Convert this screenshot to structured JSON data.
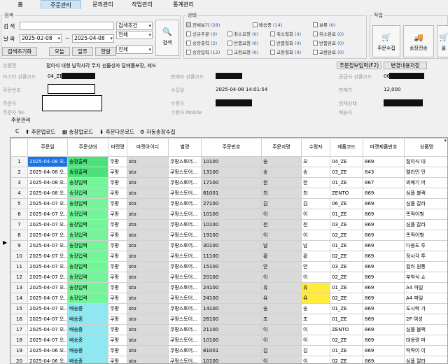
{
  "tabs": [
    "홈",
    "주문관리",
    "문의관리",
    "작업관리",
    "통계관리"
  ],
  "search": {
    "title": "검색",
    "search_label": "검 색",
    "search_condition": "검색조건",
    "all": "전체",
    "date_label": "날 짜",
    "date_from": "2025-02-08",
    "date_to": "2025-04-08",
    "date_type": "등록일",
    "tilde": "~",
    "reset": "검색조기화",
    "today": "오늘",
    "week": "일주",
    "month": "한달",
    "search_button": "검색"
  },
  "status": {
    "title": "상태",
    "items": [
      {
        "label": "전체보기",
        "count": "(28)"
      },
      {
        "label": "배송중",
        "count": "(14)"
      },
      {
        "label": "보류",
        "count": "(0)"
      },
      {
        "label": "신규주문",
        "count": "(0)"
      },
      {
        "label": "취소요청",
        "count": "(0)"
      },
      {
        "label": "취소철회",
        "count": "(0)"
      },
      {
        "label": "취소완료",
        "count": "(0)"
      },
      {
        "label": "송장출력",
        "count": "(2)"
      },
      {
        "label": "반품요청",
        "count": "(0)"
      },
      {
        "label": "반품철회",
        "count": "(0)"
      },
      {
        "label": "반품완료",
        "count": "(0)"
      },
      {
        "label": "송장입력",
        "count": "(12)"
      },
      {
        "label": "교환요청",
        "count": "(0)"
      },
      {
        "label": "교환철회",
        "count": "(0)"
      },
      {
        "label": "교환완료",
        "count": "(0)"
      }
    ]
  },
  "work": {
    "title": "작업",
    "collect": "주문수집",
    "send": "송장전송",
    "third": "올"
  },
  "detail": {
    "product_name_label": "상품명",
    "product_name": "접이식 대형 납작사각 무지 선물상자 답례품포장, 레드",
    "master_code_label": "마스터 상품코드",
    "master_code": "04_ZE",
    "seller_code_label": "판매자 상품코드",
    "supplier_code_label": "공급사 상품코드",
    "supplier_code": "06",
    "order_no_label": "주문번호",
    "collect_date_label": "수집일",
    "collect_date": "2025-04-08 14:01:54",
    "price_label": "판매가",
    "price": "12,000",
    "orderer_label": "주문자",
    "recipient_label": "수령자",
    "status_label": "현재상태",
    "orderer_tel_label": "주문자 Tel",
    "recipient_mobile_label": "수령자 Mobile",
    "delivery_label": "배송지",
    "order_info_button": "주문정보입력(F2)",
    "save_changes_button": "변경내용저장"
  },
  "grid_section": {
    "title": "주문관리",
    "refresh": "C",
    "order_upload": "주문업로드",
    "invoice_upload": "송장업로드",
    "order_download": "주문다운로드",
    "auto_invoice": "자동송장수집"
  },
  "grid": {
    "columns": [
      "주문일",
      "주문상태",
      "마켓명",
      "마켓아이디",
      "별명",
      "주문번호",
      "주문자명",
      "수령자",
      "제품코드",
      "마켓제품번호",
      "상품명"
    ],
    "rows": [
      [
        "2025-04-08 오...",
        "송장출력",
        "쿠팡",
        "sto",
        "쿠팡스토어...",
        "10100",
        "송",
        "오",
        "04_ZE",
        "869",
        "접이식 대"
      ],
      [
        "2025-04-08 오...",
        "송장출력",
        "쿠팡",
        "sto",
        "쿠팡스토어...",
        "13100",
        "송",
        "송",
        "03_ZE",
        "843",
        "멜라민 민"
      ],
      [
        "2025-04-08 오...",
        "송장입력",
        "쿠팡",
        "sto",
        "쿠팡스토어...",
        "17100",
        "한",
        "한",
        "01_ZE",
        "867",
        "꽈배기 머"
      ],
      [
        "2025-04-08 오...",
        "송장입력",
        "쿠팡",
        "sto",
        "쿠팡스토어...",
        "81001",
        "최",
        "최",
        "ZENTO",
        "869",
        "심플 블랙"
      ],
      [
        "2025-04-07 오...",
        "송장입력",
        "쿠팡",
        "sto",
        "쿠팡스토어...",
        "27100",
        "김",
        "김",
        "06_ZE",
        "869",
        "심플 칼라"
      ],
      [
        "2025-04-07 오...",
        "송장입력",
        "쿠팡",
        "sto",
        "쿠팡스토어...",
        "10100",
        "이",
        "이",
        "01_ZE",
        "869",
        "똑딱이형"
      ],
      [
        "2025-04-07 오...",
        "송장입력",
        "쿠팡",
        "sto",
        "쿠팡스토어...",
        "10100",
        "천",
        "천",
        "03_ZE",
        "869",
        "심플 칼라"
      ],
      [
        "2025-04-07 오...",
        "송장입력",
        "쿠팡",
        "sto",
        "쿠팡스토어...",
        "19100",
        "이",
        "이",
        "02_ZE",
        "869",
        "똑딱이형"
      ],
      [
        "2025-04-07 오...",
        "송장입력",
        "쿠팡",
        "sto",
        "쿠팡스토어...",
        "30100",
        "남",
        "남",
        "01_ZE",
        "869",
        "다용도 투"
      ],
      [
        "2025-04-07 오...",
        "송장입력",
        "쿠팡",
        "sto",
        "쿠팡스토어...",
        "11100",
        "황",
        "황",
        "02_ZE",
        "869",
        "정사각 투"
      ],
      [
        "2025-04-07 오...",
        "송장입력",
        "쿠팡",
        "sto",
        "쿠팡스토어...",
        "15100",
        "안",
        "안",
        "03_ZE",
        "869",
        "컬러 원통"
      ],
      [
        "2025-04-07 오...",
        "송장입력",
        "쿠팡",
        "sto",
        "쿠팡스토어...",
        "20100",
        "이",
        "이",
        "02_ZE",
        "869",
        "부착식 쇼"
      ],
      [
        "2025-04-07 오...",
        "송장입력",
        "쿠팡",
        "sto",
        "쿠팡스토어...",
        "24100",
        "유",
        "유",
        "01_ZE",
        "869",
        "A4 파일"
      ],
      [
        "2025-04-07 오...",
        "송장입력",
        "쿠팡",
        "sto",
        "쿠팡스토어...",
        "24100",
        "유",
        "유",
        "02_ZE",
        "869",
        "A4 파일"
      ],
      [
        "2025-04-07 오...",
        "배송중",
        "쿠팡",
        "sto",
        "쿠팡스토어...",
        "14100",
        "송",
        "송",
        "01_ZE",
        "869",
        "도시락 가"
      ],
      [
        "2025-04-07 오...",
        "배송중",
        "쿠팡",
        "sto",
        "쿠팡스토어...",
        "26100",
        "조",
        "조",
        "01_ZE",
        "869",
        "2P 여성"
      ],
      [
        "2025-04-07 오...",
        "배송중",
        "쿠팡",
        "sto",
        "쿠팡스토어...",
        "21100",
        "이",
        "이",
        "ZENTO",
        "869",
        "심플 블랙"
      ],
      [
        "2025-04-07 오...",
        "배송중",
        "쿠팡",
        "sto",
        "쿠팡스토어...",
        "10100",
        "이",
        "이",
        "02_ZE",
        "869",
        "대용량 마"
      ],
      [
        "2025-04-06 오...",
        "배송중",
        "쿠팡",
        "sto",
        "쿠팡스토어...",
        "81001",
        "김",
        "김",
        "01_ZE",
        "869",
        "딱딱이 이"
      ],
      [
        "2025-04-06 오...",
        "배송중",
        "쿠팡",
        "sto",
        "쿠팡스토어...",
        "10100",
        "이",
        "이",
        "02_ZE",
        "869",
        "심플 칼라"
      ]
    ],
    "row_numbers": [
      "1",
      "2",
      "3",
      "4",
      "5",
      "6",
      "7",
      "8",
      "9",
      "10",
      "11",
      "12",
      "13",
      "14",
      "15",
      "16",
      "17",
      "18",
      "19",
      "20"
    ],
    "selected_row": 0,
    "status_colors": {
      "송장출력": "#4be27a",
      "송장입력": "#74f59a",
      "배송중": "#8de8f2"
    }
  }
}
